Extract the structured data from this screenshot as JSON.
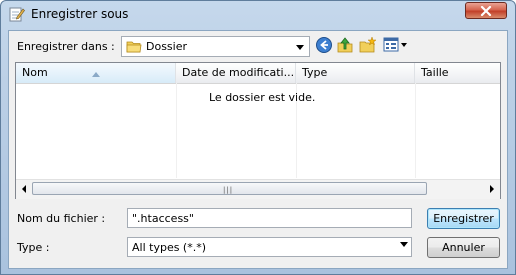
{
  "window": {
    "title": "Enregistrer sous",
    "icons": {
      "title": "notepad-pen-icon",
      "close": "close-icon"
    }
  },
  "location": {
    "label": "Enregistrer dans :",
    "value": "Dossier",
    "icon": "folder-icon"
  },
  "toolbar": {
    "icons": [
      "back-arrow-icon",
      "up-folder-icon",
      "new-folder-icon",
      "view-menu-icon"
    ]
  },
  "filelist": {
    "columns": [
      {
        "label": "Nom"
      },
      {
        "label": "Date de modificati..."
      },
      {
        "label": "Type"
      },
      {
        "label": "Taille"
      }
    ],
    "empty_message": "Le dossier est vide.",
    "scroll_grip": "|||"
  },
  "filename": {
    "label": "Nom du fichier :",
    "value": "\".htaccess\""
  },
  "filetype": {
    "label": "Type :",
    "value": "All types (*.*)"
  },
  "buttons": {
    "save": "Enregistrer",
    "cancel": "Annuler"
  },
  "colors": {
    "title_gradient_top": "#c5d8ec",
    "client_bg": "#f0f0f0",
    "default_button_border": "#3c7fb1",
    "close_button": "#c2402a"
  }
}
